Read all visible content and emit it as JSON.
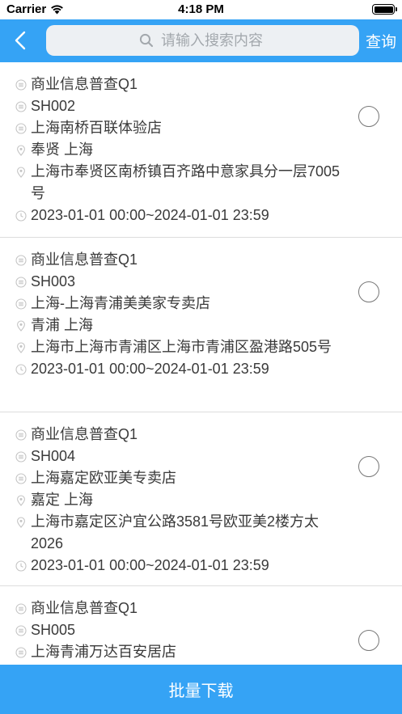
{
  "status_bar": {
    "carrier": "Carrier",
    "time": "4:18 PM"
  },
  "header": {
    "search_placeholder": "请输入搜索内容",
    "search_value": "",
    "query_label": "查询"
  },
  "icons": {
    "back": "chevron-left-icon",
    "search": "search-icon",
    "doc": "document-icon",
    "location": "location-pin-icon",
    "clock": "clock-icon",
    "radio": "radio-unchecked-icon"
  },
  "colors": {
    "accent": "#35a3f5",
    "text": "#3a3a3a",
    "icon": "#c4c4c4"
  },
  "items": [
    {
      "survey": "商业信息普查Q1",
      "code": "SH002",
      "store": "上海南桥百联体验店",
      "region": "奉贤 上海",
      "address": "上海市奉贤区南桥镇百齐路中意家具分一层7005号",
      "period": "2023-01-01 00:00~2024-01-01 23:59"
    },
    {
      "survey": "商业信息普查Q1",
      "code": "SH003",
      "store": "上海-上海青浦美美家专卖店",
      "region": "青浦 上海",
      "address": "上海市上海市青浦区上海市青浦区盈港路505号",
      "period": "2023-01-01 00:00~2024-01-01 23:59"
    },
    {
      "survey": "商业信息普查Q1",
      "code": "SH004",
      "store": "上海嘉定欧亚美专卖店",
      "region": "嘉定 上海",
      "address": "上海市嘉定区沪宜公路3581号欧亚美2楼方太2026",
      "period": "2023-01-01 00:00~2024-01-01 23:59"
    },
    {
      "survey": "商业信息普查Q1",
      "code": "SH005",
      "store": "上海青浦万达百安居店",
      "region": "",
      "address": "",
      "period": ""
    }
  ],
  "bottom": {
    "batch_download_label": "批量下载"
  }
}
